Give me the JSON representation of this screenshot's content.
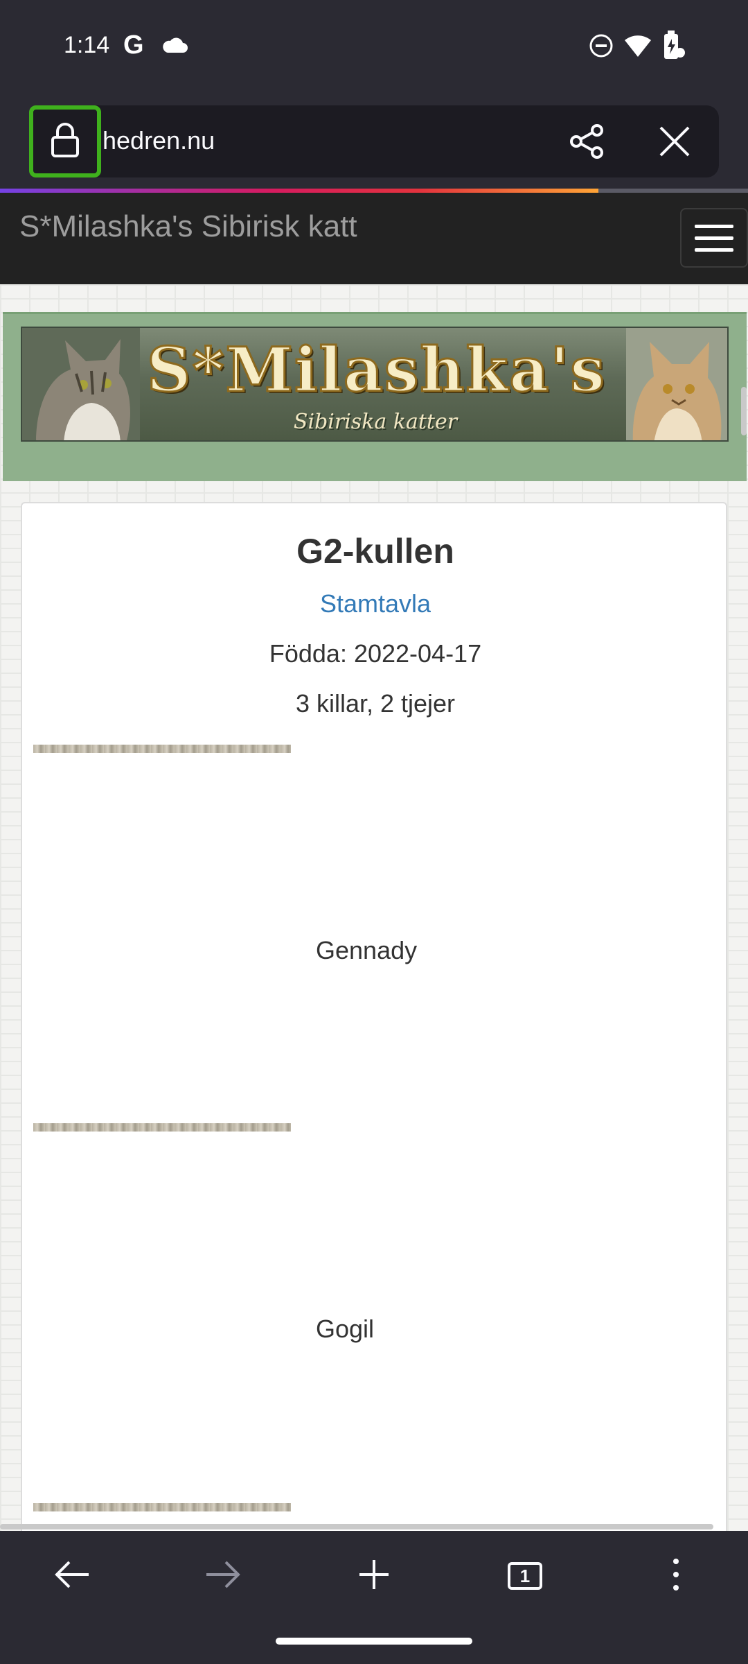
{
  "status_bar": {
    "time": "1:14",
    "left_icons": [
      "google-icon",
      "cloud-icon"
    ],
    "right_icons": [
      "do-not-disturb-icon",
      "wifi-icon",
      "battery-charging-icon"
    ]
  },
  "browser": {
    "url": "hedren.nu",
    "load_progress": 0.8,
    "toolbar_icons": [
      "back-arrow-icon",
      "forward-arrow-icon",
      "plus-icon",
      "tabs-icon",
      "menu-icon"
    ],
    "tab_count": "1",
    "colors": {
      "chrome": "#2b2a33",
      "url_field": "#1c1b22",
      "lock_highlight": "#3fb11d"
    }
  },
  "site": {
    "title": "S*Milashka's Sibirisk katt",
    "banner": {
      "title": "S*Milashka's",
      "subtitle": "Sibiriska katter"
    }
  },
  "content": {
    "heading": "G2-kullen",
    "pedigree_link": "Stamtavla",
    "born": "Födda: 2022-04-17",
    "litter": "3 killar, 2 tjejer",
    "kittens": [
      {
        "name": "Gennady"
      },
      {
        "name": "Gogil"
      }
    ],
    "colors": {
      "link": "#337ab7",
      "text": "#333333",
      "banner_bg": "#8fb08c"
    }
  }
}
